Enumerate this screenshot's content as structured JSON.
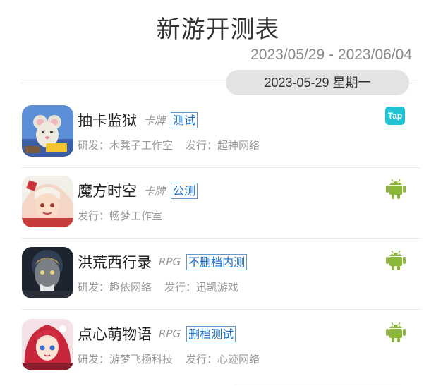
{
  "header": {
    "title": "新游开测表",
    "date_range": "2023/05/29 - 2023/06/04"
  },
  "day": {
    "label": "2023-05-29 星期一"
  },
  "games": [
    {
      "name": "抽卡监狱",
      "genre": "卡牌",
      "test_type": "测试",
      "meta": [
        "研发：木凳子工作室",
        "发行：超神网络"
      ],
      "platform": "taptap-icon",
      "platform_label": "Tap",
      "icon": "game-icon-mouse"
    },
    {
      "name": "魔方时空",
      "genre": "卡牌",
      "test_type": "公测",
      "meta": [
        "发行：畅梦工作室"
      ],
      "platform": "android-icon",
      "icon": "game-icon-anime-girl"
    },
    {
      "name": "洪荒西行录",
      "genre": "RPG",
      "test_type": "不删档内测",
      "meta": [
        "研发：趣依网络",
        "发行：迅凯游戏"
      ],
      "platform": "android-icon",
      "icon": "game-icon-warrior"
    },
    {
      "name": "点心萌物语",
      "genre": "RPG",
      "test_type": "删档测试",
      "meta": [
        "研发：游梦飞扬科技",
        "发行：心迹网络"
      ],
      "platform": "android-icon",
      "icon": "game-icon-red-hair-girl"
    }
  ],
  "colors": {
    "badge_text": "#1a73c8",
    "android": "#8cb83a",
    "taptap": "#1fc3d1",
    "pill_bg": "#e3e3e3"
  }
}
